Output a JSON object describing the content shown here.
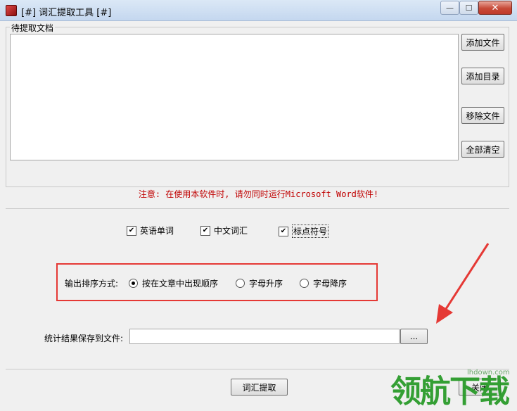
{
  "window": {
    "title": "[#] 词汇提取工具 [#]"
  },
  "winbuttons": {
    "minimize": "—",
    "maximize": "☐",
    "close": "✕"
  },
  "group_docs": {
    "label": "待提取文档"
  },
  "buttons": {
    "add_file": "添加文件",
    "add_dir": "添加目录",
    "remove_file": "移除文件",
    "clear_all": "全部清空",
    "extract": "词汇提取",
    "close": "关闭",
    "browse": "..."
  },
  "notice": "注意: 在使用本软件时, 请勿同时运行Microsoft Word软件!",
  "options": {
    "english_words": {
      "label": "英语单词",
      "checked": true
    },
    "chinese_words": {
      "label": "中文词汇",
      "checked": true
    },
    "punctuation": {
      "label": "标点符号",
      "checked": true
    }
  },
  "sort": {
    "label": "输出排序方式:",
    "choices": [
      {
        "label": "按在文章中出现顺序",
        "selected": true
      },
      {
        "label": "字母升序",
        "selected": false
      },
      {
        "label": "字母降序",
        "selected": false
      }
    ]
  },
  "output": {
    "label": "统计结果保存到文件:",
    "value": ""
  },
  "watermark": {
    "text": "领航下载",
    "url": "lhdown.com"
  },
  "colors": {
    "accent_red": "#e53935",
    "notice_red": "#c00000",
    "watermark_green": "#2a9b2a"
  }
}
